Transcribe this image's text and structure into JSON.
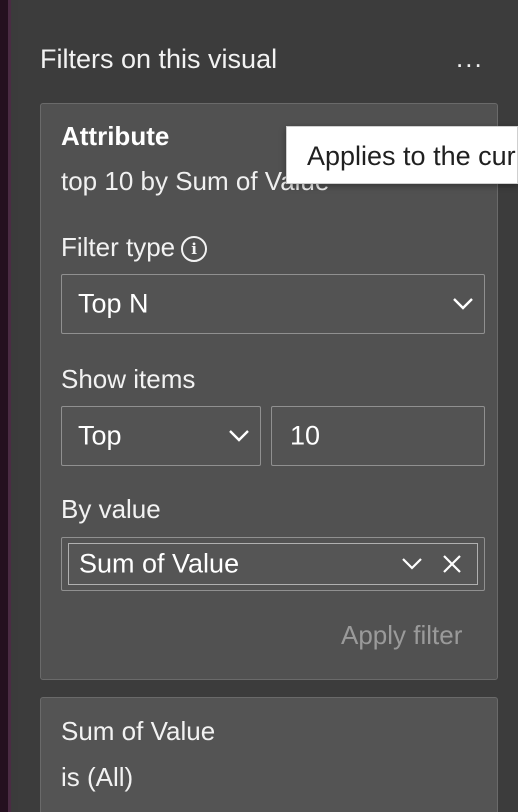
{
  "pane": {
    "title": "Filters on this visual",
    "more_label": "..."
  },
  "attribute_card": {
    "title": "Attribute",
    "subtitle": "top 10 by Sum of Value",
    "filter_type": {
      "label": "Filter type",
      "info_glyph": "i",
      "selected": "Top N"
    },
    "show_items": {
      "label": "Show items",
      "direction": "Top",
      "count": "10"
    },
    "by_value": {
      "label": "By value",
      "field": "Sum of Value"
    },
    "apply_label": "Apply filter"
  },
  "value_card": {
    "title": "Sum of Value",
    "condition": "is (All)"
  },
  "tooltip": {
    "text": "Applies to the current visual"
  },
  "colors": {
    "pane_bg": "#3c3c3c",
    "card_bg": "#515151",
    "border": "#909090",
    "text": "#ffffff",
    "disabled_text": "#9a9a9a",
    "accent_edge": "#24101f"
  },
  "icons": {
    "more": "ellipsis-icon",
    "info": "info-icon",
    "dropdown": "chevron-down-icon",
    "remove": "close-icon"
  }
}
